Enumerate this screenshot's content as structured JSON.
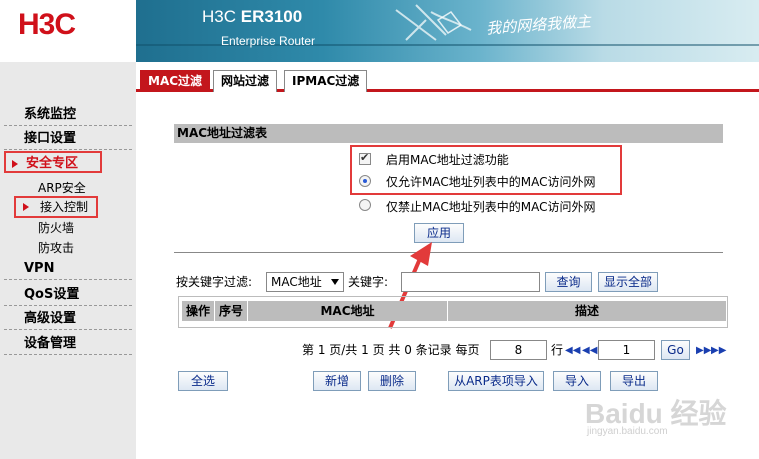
{
  "logo": "H3C",
  "header": {
    "product_prefix": "H3C",
    "product_model": "ER3100",
    "subtitle": "Enterprise Router",
    "slogan": "我的网络我做主"
  },
  "sidebar": {
    "items": [
      {
        "label": "系统监控"
      },
      {
        "label": "接口设置"
      },
      {
        "label": "安全专区"
      },
      {
        "label": "VPN"
      },
      {
        "label": "QoS设置"
      },
      {
        "label": "高级设置"
      },
      {
        "label": "设备管理"
      }
    ],
    "subitems": [
      {
        "label": "ARP安全"
      },
      {
        "label": "接入控制"
      },
      {
        "label": "防火墙"
      },
      {
        "label": "防攻击"
      }
    ]
  },
  "tabs": [
    {
      "label": "MAC过滤"
    },
    {
      "label": "网站过滤"
    },
    {
      "label": "IPMAC过滤"
    }
  ],
  "section": {
    "title": "MAC地址过滤表",
    "enable_label": "启用MAC地址过滤功能",
    "allow_label": "仅允许MAC地址列表中的MAC访问外网",
    "deny_label": "仅禁止MAC地址列表中的MAC访问外网",
    "apply_label": "应用"
  },
  "filter": {
    "by_keyword_label": "按关键字过滤:",
    "select_value": "MAC地址",
    "keyword_label": "关键字:",
    "keyword_value": "",
    "query_label": "查询",
    "show_all_label": "显示全部"
  },
  "table": {
    "columns": [
      "操作",
      "序号",
      "MAC地址",
      "描述"
    ]
  },
  "pager": {
    "text": "第 1 页/共 1 页 共 0 条记录 每页",
    "per_page": "8",
    "rows_label": "行",
    "page_value": "1",
    "go_label": "Go"
  },
  "actions": {
    "select_all": "全选",
    "add": "新增",
    "delete": "删除",
    "import_arp": "从ARP表项导入",
    "import": "导入",
    "export": "导出"
  },
  "watermark": {
    "main": "Baidu 经验",
    "sub": "jingyan.baidu.com"
  }
}
